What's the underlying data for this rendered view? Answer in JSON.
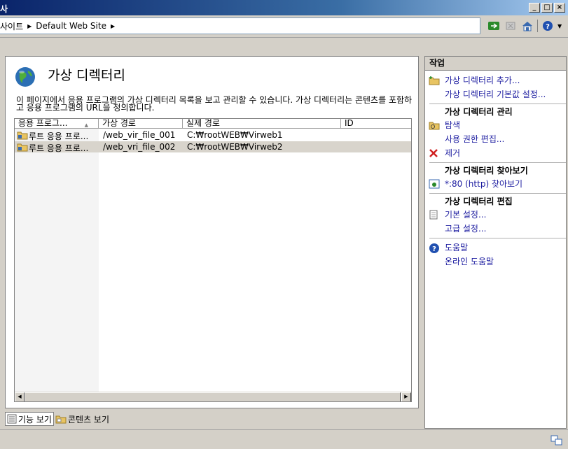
{
  "window": {
    "title": "사"
  },
  "address": {
    "crumbs": [
      "사이트",
      "Default Web Site"
    ]
  },
  "page": {
    "title": "가상 디렉터리",
    "description": "이 페이지에서 응용 프로그램의 가상 디렉터리 목록을 보고 관리할 수 있습니다. 가상 디렉터리는 콘텐츠를 포함하고 응용 프로그램의 URL을 정의합니다."
  },
  "grid": {
    "columns": [
      "응용 프로그...",
      "가상 경로",
      "실제 경로",
      "ID"
    ],
    "rows": [
      {
        "app": "루트 응용 프로...",
        "vpath": "/web_vir_file_001",
        "ppath": "C:₩rootWEB₩Virweb1",
        "id": ""
      },
      {
        "app": "루트 응용 프로...",
        "vpath": "/web_vri_file_002",
        "ppath": "C:₩rootWEB₩Virweb2",
        "id": ""
      }
    ],
    "selected_row": 1
  },
  "views": {
    "features": "기능 보기",
    "content": "콘텐츠 보기"
  },
  "actions": {
    "header": "작업",
    "add": "가상 디렉터리 추가...",
    "defaults": "가상 디렉터리 기본값 설정...",
    "manage_group": "가상 디렉터리 관리",
    "explore": "탐색",
    "edit_perms": "사용 권한 편집...",
    "remove": "제거",
    "browse_group": "가상 디렉터리 찾아보기",
    "browse_http": "*:80 (http) 찾아보기",
    "edit_group": "가상 디렉터리 편집",
    "basic": "기본 설정...",
    "advanced": "고급 설정...",
    "help": "도움말",
    "online_help": "온라인 도움말"
  },
  "colors": {
    "link": "#1c1ca0",
    "selected_row": "#d8d4cc",
    "titlebar": "#0a246a"
  }
}
